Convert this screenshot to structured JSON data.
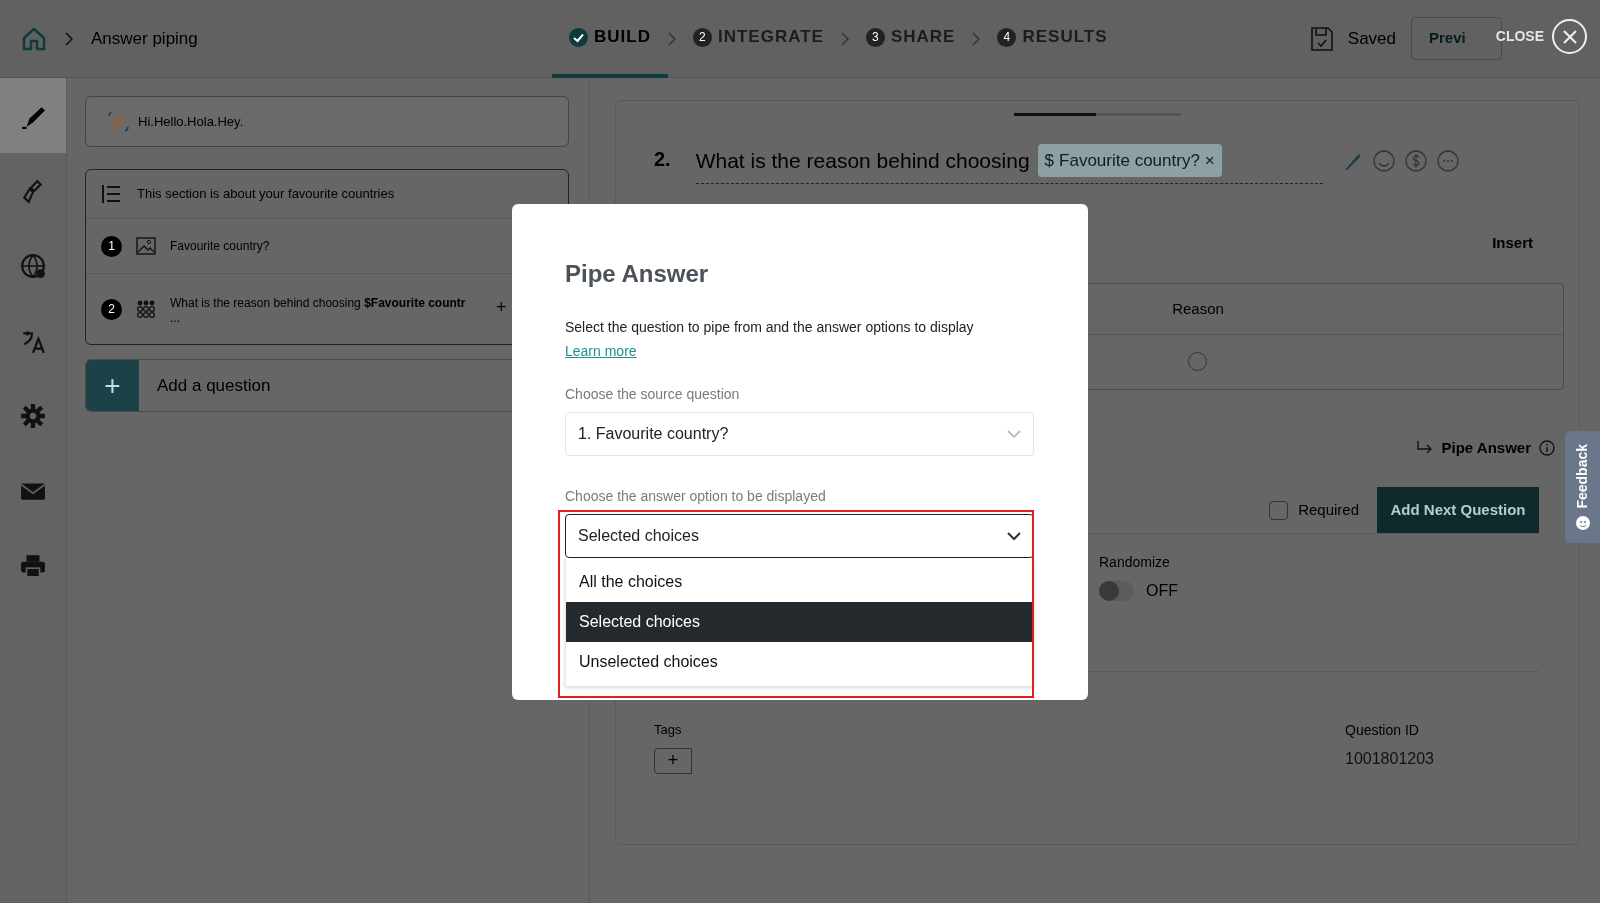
{
  "header": {
    "breadcrumb": "Answer piping",
    "steps": [
      {
        "label": "BUILD",
        "done": true,
        "selected": true
      },
      {
        "label": "INTEGRATE",
        "number": "2",
        "done": false,
        "selected": false
      },
      {
        "label": "SHARE",
        "number": "3",
        "done": false,
        "selected": false
      },
      {
        "label": "RESULTS",
        "number": "4",
        "done": false,
        "selected": false
      }
    ],
    "saved": "Saved",
    "preview": "Previ",
    "close": "CLOSE"
  },
  "rail": [
    {
      "kind": "pencil",
      "selected": true
    },
    {
      "kind": "brush",
      "selected": false
    },
    {
      "kind": "globe",
      "selected": false
    },
    {
      "kind": "translate",
      "selected": false
    },
    {
      "kind": "gear",
      "selected": false
    },
    {
      "kind": "mail",
      "selected": false
    },
    {
      "kind": "printer",
      "selected": false
    }
  ],
  "outline": {
    "welcome": "Hi.Hello.Hola.Hey.",
    "section": "This section is about your favourite countries",
    "questions": [
      {
        "number": "1",
        "kind": "image",
        "text": "Favourite country?"
      },
      {
        "number": "2",
        "kind": "grid",
        "text": "What is the reason behind choosing **$Favourite countr**",
        "more": "...",
        "add": "+"
      }
    ],
    "add_question": {
      "icon": "+",
      "label": "Add a question"
    }
  },
  "editor": {
    "progress": {
      "level": 0.49
    },
    "number": "2.",
    "title": "What is the reason behind choosing",
    "chip": {
      "symbol": "$",
      "label": "Favourite country?",
      "remove": "×"
    },
    "insert": "Insert",
    "table_header": "Reason",
    "table_radio": {
      "checked": false
    },
    "pipe_answer": "Pipe Answer",
    "required": {
      "label": "Required",
      "checked": false
    },
    "add_next": "Add Next Question",
    "randomize": {
      "label": "Randomize",
      "on": false,
      "state": "OFF"
    },
    "tags": {
      "label": "Tags",
      "add": "+"
    },
    "question_id": {
      "label": "Question ID",
      "value": "1001801203"
    }
  },
  "feedback": "Feedback",
  "modal": {
    "title": "Pipe Answer",
    "description": "Select the question to pipe from and the answer options to display",
    "learn_more": "Learn more",
    "source_label": "Choose the source question",
    "source_value": "1. Favourite country?",
    "option_label": "Choose the answer option to be displayed",
    "option_value": "Selected choices",
    "options": [
      {
        "label": "All the choices",
        "selected": false
      },
      {
        "label": "Selected choices",
        "selected": true
      },
      {
        "label": "Unselected choices",
        "selected": false
      }
    ]
  }
}
